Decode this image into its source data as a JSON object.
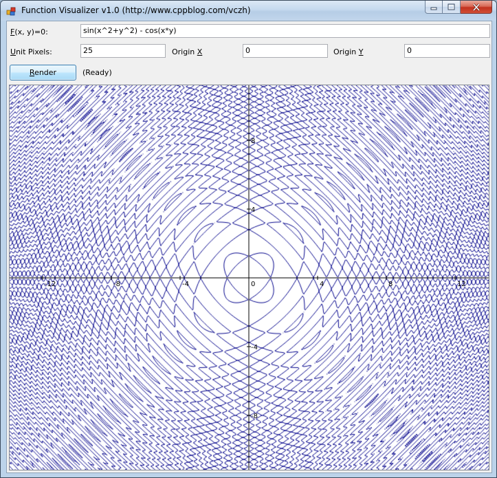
{
  "window": {
    "title": "Function Visualizer v1.0 (http://www.cppblog.com/vczh)"
  },
  "form": {
    "function_label": "F(x, y)=0:",
    "function_value": "sin(x^2+y^2) - cos(x*y)",
    "unit_pixels_label": "Unit Pixels:",
    "unit_pixels_value": "25",
    "origin_x_label": "Origin X",
    "origin_x_value": "0",
    "origin_y_label": "Origin Y",
    "origin_y_value": "0",
    "render_label": "Render",
    "status": "(Ready)"
  },
  "icons": {
    "app": "app-icon",
    "minimize": "minimize-icon",
    "maximize": "maximize-icon",
    "close": "close-icon"
  },
  "chart_data": {
    "type": "line",
    "equation": "sin(x^2+y^2) - cos(x*y) = 0",
    "curve_color": "#00008b",
    "axis_color": "#000000",
    "unit_pixels": 25,
    "origin": [
      0,
      0
    ],
    "x_ticks": [
      -12,
      -8,
      -4,
      0,
      4,
      8,
      12
    ],
    "y_ticks": [
      8,
      4,
      -4,
      -8
    ],
    "xlim": [
      -14,
      14
    ],
    "ylim": [
      -11.2,
      11.2
    ],
    "origin_label": "0",
    "grid": false
  }
}
